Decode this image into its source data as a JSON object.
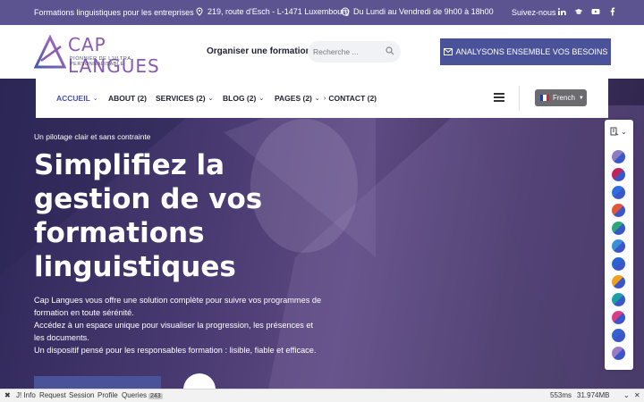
{
  "topbar": {
    "tagline": "Formations linguistiques pour les entreprises",
    "address": "219, route d'Esch - L-1471 Luxembourg",
    "hours": "Du Lundi au Vendredi de 9h00 à 18h00",
    "follow": "Suivez-nous",
    "social_icons": [
      "linkedin-icon",
      "graduation-cap-icon",
      "youtube-icon",
      "facebook-icon"
    ]
  },
  "header": {
    "logo_brand": "CAP LANGUES",
    "logo_tagline": "PIONNIER DE L'ULTRA PERSONNALISABLE",
    "organise_link": "Organiser une formation",
    "search_placeholder": "Recherche ...",
    "cta_label": "ANALYSONS ENSEMBLE VOS BESOINS"
  },
  "nav": {
    "items": [
      {
        "label": "ACCUEIL",
        "active": true,
        "dropdown": true
      },
      {
        "label": "ABOUT (2)",
        "active": false,
        "dropdown": false
      },
      {
        "label": "SERVICES (2)",
        "active": false,
        "dropdown": true
      },
      {
        "label": "BLOG (2)",
        "active": false,
        "dropdown": true
      },
      {
        "label": "PAGES (2)",
        "active": false,
        "dropdown": true
      },
      {
        "label": "CONTACT (2)",
        "active": false,
        "dropdown": false
      }
    ],
    "language": "French"
  },
  "hero": {
    "eyebrow": "Un pilotage clair et sans contrainte",
    "title": "Simplifiez la gestion de vos formations linguistiques",
    "desc_lines": [
      "Cap Langues vous offre une solution complète pour suivre vos programmes de",
      "formation en toute sérénité.",
      "Accédez à un espace unique pour visualiser la progression, les présences et",
      "les documents.",
      "Un dispositif pensé pour les responsables formation : lisible, fiable et efficace."
    ]
  },
  "switcher": {
    "colors": [
      "#8e7cc3",
      "#c0245a",
      "#2f6fdd",
      "#e2573b",
      "#2aa57c",
      "#3a8fd9",
      "#2a64d0",
      "#f0a020",
      "#1ba0a8",
      "#d93e86",
      "#3461cf",
      "#9b7ac6"
    ]
  },
  "debugbar": {
    "tabs": [
      "Info",
      "Request",
      "Session",
      "Profile",
      "Queries"
    ],
    "queries_count": "243",
    "time": "553ms",
    "memory": "31.974MB"
  },
  "colors": {
    "topbar": "#5c5490",
    "accent": "#4a5299",
    "hero": "#4a3b72"
  }
}
